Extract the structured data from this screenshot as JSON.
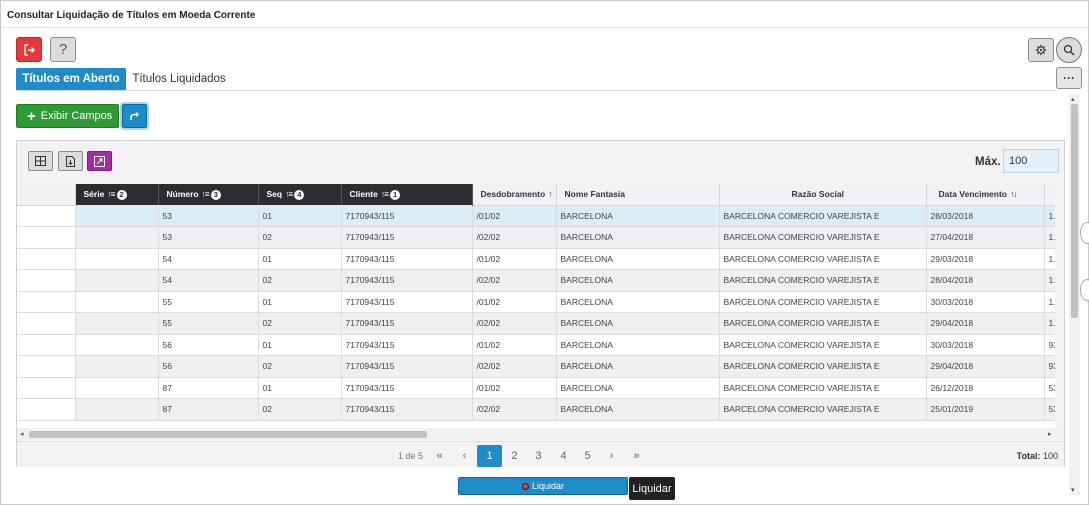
{
  "window": {
    "title": "Consultar Liquidação de Títulos em Moeda Corrente"
  },
  "toolbar": {
    "help_label": "?"
  },
  "tabs": [
    {
      "label": "Títulos em Aberto",
      "active": true
    },
    {
      "label": "Títulos Liquidados",
      "active": false
    }
  ],
  "actions": {
    "exibir_campos_label": "Exibir Campos",
    "more_label": "···"
  },
  "filters": {
    "max_label": "Máx.",
    "max_value": "100"
  },
  "table": {
    "columns": [
      {
        "label": "",
        "style": "first"
      },
      {
        "label": "Série",
        "style": "dark",
        "sort_rank": "2"
      },
      {
        "label": "Número",
        "style": "dark",
        "sort_rank": "3"
      },
      {
        "label": "Seq",
        "style": "dark",
        "sort_rank": "4"
      },
      {
        "label": "Cliente",
        "style": "dark",
        "sort_rank": "1"
      },
      {
        "label": "Desdobramento",
        "style": "light"
      },
      {
        "label": "Nome Fantasia",
        "style": "light"
      },
      {
        "label": "Razão Social",
        "style": "light"
      },
      {
        "label": "Data Vencimento",
        "style": "light"
      },
      {
        "label": "",
        "style": "light"
      }
    ],
    "rows": [
      [
        "",
        "",
        "53",
        "01",
        "7170943/115",
        "/01/02",
        "BARCELONA",
        "BARCELONA COMERCIO VAREJISTA E",
        "28/03/2018",
        "1."
      ],
      [
        "",
        "",
        "53",
        "02",
        "7170943/115",
        "/02/02",
        "BARCELONA",
        "BARCELONA COMERCIO VAREJISTA E",
        "27/04/2018",
        "1."
      ],
      [
        "",
        "",
        "54",
        "01",
        "7170943/115",
        "/01/02",
        "BARCELONA",
        "BARCELONA COMERCIO VAREJISTA E",
        "29/03/2018",
        "1."
      ],
      [
        "",
        "",
        "54",
        "02",
        "7170943/115",
        "/02/02",
        "BARCELONA",
        "BARCELONA COMERCIO VAREJISTA E",
        "28/04/2018",
        "1."
      ],
      [
        "",
        "",
        "55",
        "01",
        "7170943/115",
        "/01/02",
        "BARCELONA",
        "BARCELONA COMERCIO VAREJISTA E",
        "30/03/2018",
        "1."
      ],
      [
        "",
        "",
        "55",
        "02",
        "7170943/115",
        "/02/02",
        "BARCELONA",
        "BARCELONA COMERCIO VAREJISTA E",
        "29/04/2018",
        "1."
      ],
      [
        "",
        "",
        "56",
        "01",
        "7170943/115",
        "/01/02",
        "BARCELONA",
        "BARCELONA COMERCIO VAREJISTA E",
        "30/03/2018",
        "93"
      ],
      [
        "",
        "",
        "56",
        "02",
        "7170943/115",
        "/02/02",
        "BARCELONA",
        "BARCELONA COMERCIO VAREJISTA E",
        "29/04/2018",
        "93"
      ],
      [
        "",
        "",
        "87",
        "01",
        "7170943/115",
        "/01/02",
        "BARCELONA",
        "BARCELONA COMERCIO VAREJISTA E",
        "26/12/2018",
        "53"
      ],
      [
        "",
        "",
        "87",
        "02",
        "7170943/115",
        "/02/02",
        "BARCELONA",
        "BARCELONA COMERCIO VAREJISTA E",
        "25/01/2019",
        "53"
      ]
    ]
  },
  "pager": {
    "info": "1 de 5",
    "first": "«",
    "prev": "‹",
    "pages": [
      "1",
      "2",
      "3",
      "4",
      "5"
    ],
    "current_page": "1",
    "next": "›",
    "last": "»",
    "total_label": "Total:",
    "total_value": "100"
  },
  "footer": {
    "liquidar_label": "Liquidar",
    "tooltip": "Liquidar"
  },
  "colors": {
    "accent": "#1e8cc8",
    "success": "#2f9a33",
    "danger": "#e8373b",
    "purple": "#a72ba8",
    "header_dark": "#2d2d2d",
    "selected_row": "#daedf4"
  },
  "icons": [
    "exit-icon",
    "help-icon",
    "gear-icon",
    "search-icon",
    "more-icon",
    "plus-icon",
    "share-icon",
    "grid-icon",
    "export-icon",
    "expand-icon",
    "sort-icon"
  ]
}
